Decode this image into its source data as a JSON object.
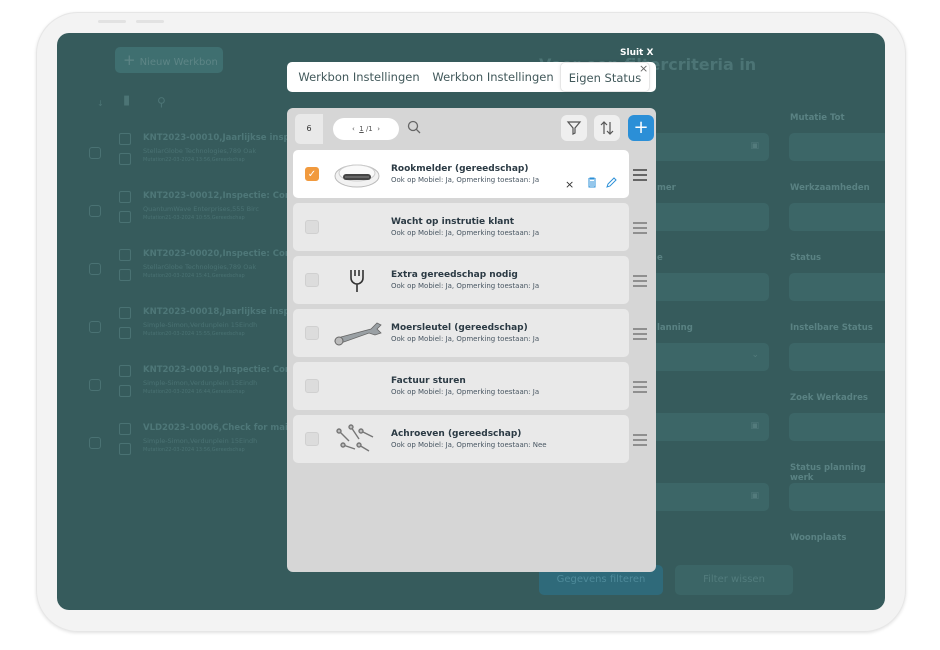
{
  "app": {
    "new_button_label": "Nieuw Werkbon",
    "bg_heading": "Voer een filtercriteria in"
  },
  "background_rows": [
    {
      "title": "KNT2023-00010,Jaarlijkse insp",
      "sub": "StellarGlobe Technologies,789 Oak",
      "meta": "Mutation22-03-2024 13:56,Gereedschap"
    },
    {
      "title": "KNT2023-00012,Inspectie: Cor",
      "sub": "QuantumWave Enterprises,555 Birc",
      "meta": "Mutation21-03-2024 10:55,Gereedschap"
    },
    {
      "title": "KNT2023-00020,Inspectie: Cor",
      "sub": "StellarGlobe Technologies,789 Oak",
      "meta": "Mutation20-03-2024 15:41,Gereedschap"
    },
    {
      "title": "KNT2023-00018,Jaarlijkse insp",
      "sub": "Simple-Simon,Verdunplein 15Eindh",
      "meta": "Mutation20-03-2024 15:55,Gereedschap"
    },
    {
      "title": "KNT2023-00019,Inspectie: Cor",
      "sub": "Simple-Simon,Verdunplein 15Eindh",
      "meta": "Mutation20-03-2024 16:44,Gereedschap"
    },
    {
      "title": "VLD2023-10006,Check for mai",
      "sub": "Simple-Simon,Verdunplein 15Eindh",
      "meta": "Mutation22-03-2024 13:56,Gereedschap"
    }
  ],
  "right_labels": [
    "Mutatie Tot",
    "Werkzaamheden",
    "Status",
    "Instelbare Status",
    "Zoek Werkadres",
    "Status planning werk",
    "Woonplaats"
  ],
  "mid_labels": [
    "mer",
    "e",
    "lanning"
  ],
  "filter_buttons": {
    "apply": "Gegevens filteren",
    "clear": "Filter wissen"
  },
  "modal": {
    "close_label": "Sluit X",
    "close_icon": "×",
    "tabs": [
      "Werkbon Instellingen",
      "Werkbon Instellingen",
      "Eigen Status"
    ],
    "active_tab": 2,
    "count": "6",
    "page_current": "1",
    "page_total": "/1",
    "items": [
      {
        "name": "Rookmelder (gereedschap)",
        "sub": "Ook op Mobiel: Ja, Opmerking toestaan: Ja",
        "checked": true,
        "thumb": "smoke-detector"
      },
      {
        "name": "Wacht op instrutie klant",
        "sub": "Ook op Mobiel: Ja, Opmerking toestaan: Ja",
        "checked": false,
        "thumb": ""
      },
      {
        "name": "Extra gereedschap nodig",
        "sub": "Ook op Mobiel: Ja, Opmerking toestaan: Ja",
        "checked": false,
        "thumb": "plug-icon"
      },
      {
        "name": "Moersleutel (gereedschap)",
        "sub": "Ook op Mobiel: Ja, Opmerking toestaan: Ja",
        "checked": false,
        "thumb": "wrench"
      },
      {
        "name": "Factuur sturen",
        "sub": "Ook op Mobiel: Ja, Opmerking toestaan: Ja",
        "checked": false,
        "thumb": ""
      },
      {
        "name": "Achroeven (gereedschap)",
        "sub": "Ook op Mobiel: Ja, Opmerking toestaan: Nee",
        "checked": false,
        "thumb": "screws"
      }
    ]
  },
  "colors": {
    "accent": "#2b8fd7",
    "check": "#f19a3e",
    "screen": "#365b5c"
  }
}
